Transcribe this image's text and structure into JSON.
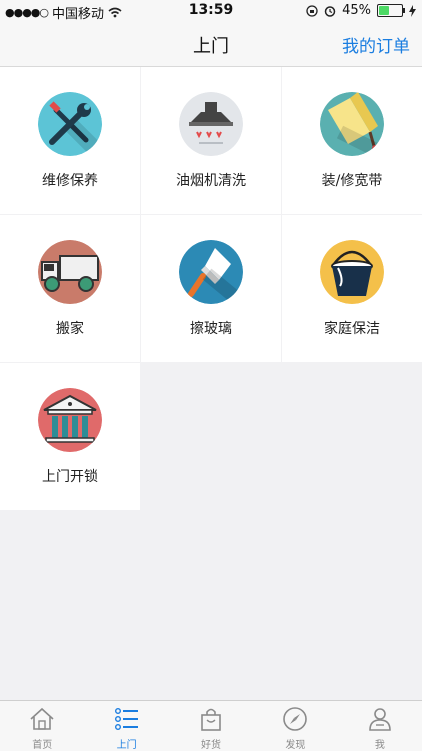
{
  "status_bar": {
    "signal": "●●●●○",
    "carrier": "中国移动",
    "time": "13:59",
    "battery": "45%",
    "battery_level_fraction": 0.45
  },
  "nav": {
    "title": "上门",
    "action": "我的订单"
  },
  "services": [
    {
      "label": "维修保养",
      "icon": "wrench-screwdriver-icon"
    },
    {
      "label": "油烟机清洗",
      "icon": "range-hood-icon"
    },
    {
      "label": "装/修宽带",
      "icon": "paint-roller-icon"
    },
    {
      "label": "搬家",
      "icon": "truck-icon"
    },
    {
      "label": "擦玻璃",
      "icon": "glass-wiper-icon"
    },
    {
      "label": "家庭保洁",
      "icon": "bucket-icon"
    },
    {
      "label": "上门开锁",
      "icon": "building-icon"
    }
  ],
  "tabs": [
    {
      "label": "首页",
      "icon": "home-icon"
    },
    {
      "label": "上门",
      "icon": "list-icon",
      "active": true
    },
    {
      "label": "好货",
      "icon": "shopping-bag-icon"
    },
    {
      "label": "发现",
      "icon": "compass-icon"
    },
    {
      "label": "我",
      "icon": "person-icon"
    }
  ],
  "colors": {
    "accent": "#1a7de0",
    "background": "#f1f1f3"
  }
}
